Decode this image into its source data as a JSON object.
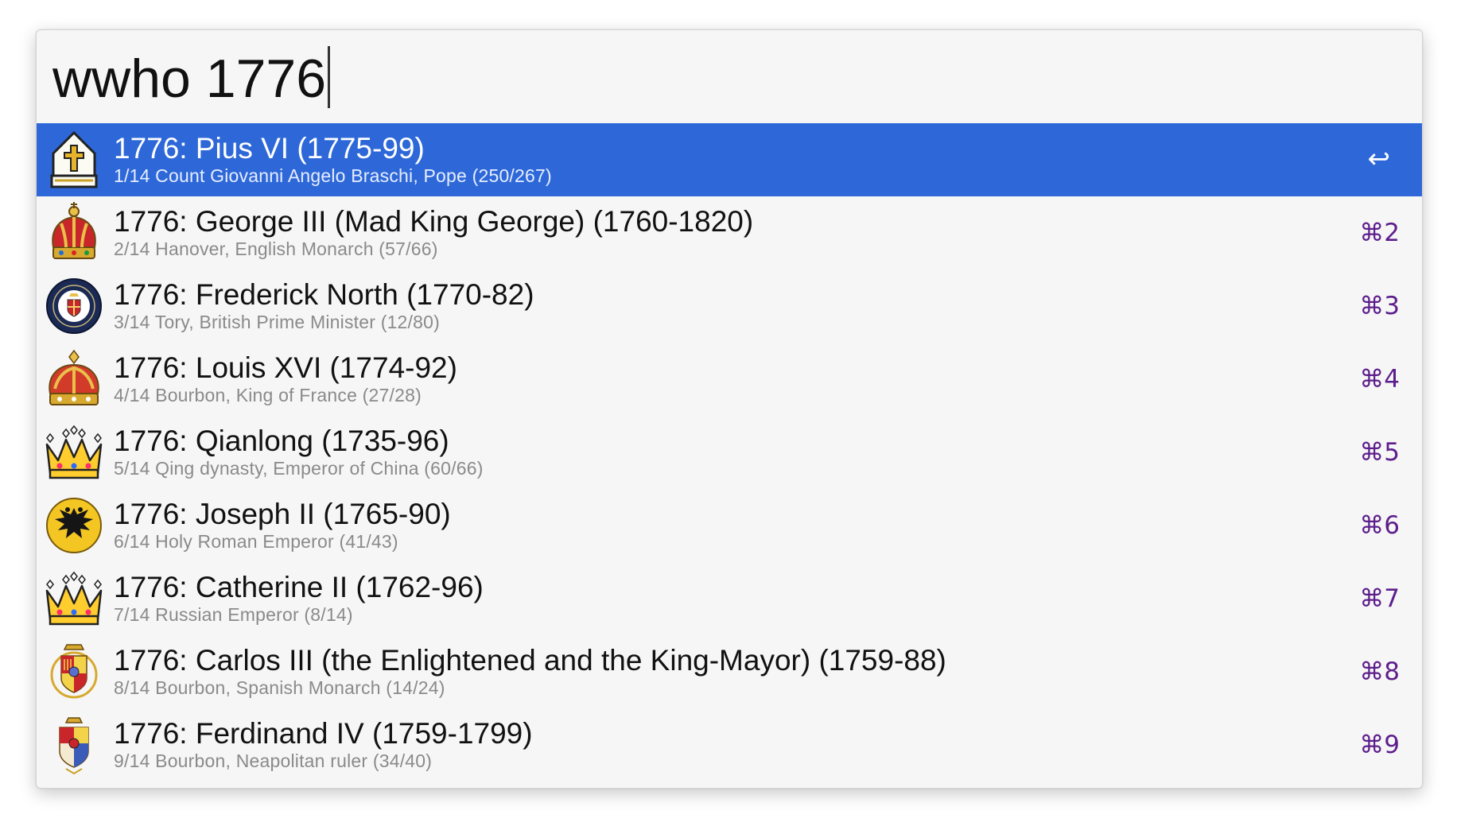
{
  "search": {
    "query": "wwho 1776"
  },
  "results": [
    {
      "title": "1776: Pius VI (1775-99)",
      "subtitle": "1/14 Count Giovanni Angelo Braschi, Pope (250/267)",
      "icon": "papal-mitre-icon",
      "action": "↩"
    },
    {
      "title": "1776: George III (Mad King George) (1760-1820)",
      "subtitle": "2/14 Hanover, English Monarch (57/66)",
      "icon": "british-crown-icon",
      "shortcut": "⌘2"
    },
    {
      "title": "1776: Frederick North (1770-82)",
      "subtitle": "3/14 Tory, British Prime Minister (12/80)",
      "icon": "prime-minister-seal-icon",
      "shortcut": "⌘3"
    },
    {
      "title": "1776: Louis XVI (1774-92)",
      "subtitle": "4/14 Bourbon, King of France (27/28)",
      "icon": "french-crown-icon",
      "shortcut": "⌘4"
    },
    {
      "title": "1776: Qianlong (1735-96)",
      "subtitle": "5/14 Qing dynasty, Emperor of China (60/66)",
      "icon": "crown-emoji-icon",
      "shortcut": "⌘5"
    },
    {
      "title": "1776: Joseph II (1765-90)",
      "subtitle": "6/14 Holy Roman Emperor (41/43)",
      "icon": "imperial-eagle-icon",
      "shortcut": "⌘6"
    },
    {
      "title": "1776: Catherine II (1762-96)",
      "subtitle": "7/14 Russian Emperor (8/14)",
      "icon": "crown-emoji-icon",
      "shortcut": "⌘7"
    },
    {
      "title": "1776: Carlos III (the Enlightened and the King-Mayor) (1759-88)",
      "subtitle": "8/14 Bourbon, Spanish Monarch (14/24)",
      "icon": "spanish-coat-of-arms-icon",
      "shortcut": "⌘8"
    },
    {
      "title": "1776: Ferdinand IV (1759-1799)",
      "subtitle": "9/14 Bourbon, Neapolitan ruler (34/40)",
      "icon": "neapolitan-coat-of-arms-icon",
      "shortcut": "⌘9"
    }
  ],
  "colors": {
    "selection": "#2e68d8",
    "shortcut": "#5d1e8c",
    "subtitle": "#8a8a8a"
  }
}
